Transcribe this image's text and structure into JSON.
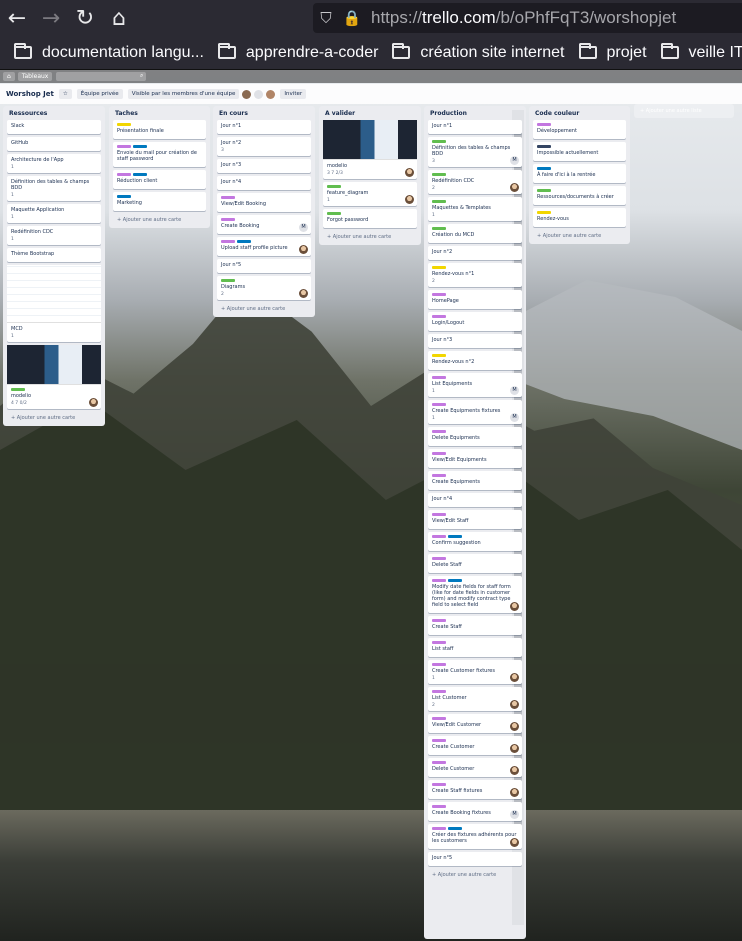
{
  "browser": {
    "url_prefix": "https://",
    "url_host": "trello.com",
    "url_path": "/b/oPhfFqT3/worshopjet",
    "bookmarks": [
      "documentation langu...",
      "apprendre-a-coder",
      "création site internet",
      "projet",
      "veille IT"
    ]
  },
  "trello": {
    "top_tab": "Tableaux",
    "board_name": "Worshop Jet",
    "team_button": "Équipe privée",
    "visible_button": "Visible par les membres d'une équipe",
    "invite_button": "Inviter",
    "add_list": "+ Ajouter une autre liste"
  },
  "lists": [
    {
      "title": "Ressources",
      "cards": [
        {
          "text": "Slack",
          "meta": ""
        },
        {
          "text": "GitHub",
          "meta": ""
        },
        {
          "text": "Architecture de l'App",
          "meta": "1"
        },
        {
          "text": "Définition des tables & champs BDD",
          "meta": "1"
        },
        {
          "text": "Maquette Application",
          "meta": "1"
        },
        {
          "text": "Redéfinition CDC",
          "meta": "1"
        },
        {
          "text": "Thème Bootstrap",
          "meta": ""
        },
        {
          "text": "MCD",
          "meta": "1"
        },
        {
          "text": "modelio",
          "meta": "4  7  0/2"
        }
      ],
      "add": "+ Ajouter une autre carte"
    },
    {
      "title": "Taches",
      "cards": [
        {
          "text": "Présentation finale",
          "meta": ""
        },
        {
          "text": "Envoie du mail pour création de staff password",
          "meta": ""
        },
        {
          "text": "Réduction client",
          "meta": ""
        },
        {
          "text": "Marketing",
          "meta": ""
        }
      ],
      "add": "+ Ajouter une autre carte"
    },
    {
      "title": "En cours",
      "cards": [
        {
          "text": "Jour n°1",
          "meta": ""
        },
        {
          "text": "Jour n°2",
          "meta": "3"
        },
        {
          "text": "Jour n°3",
          "meta": ""
        },
        {
          "text": "Jour n°4",
          "meta": ""
        },
        {
          "text": "View/Edit Booking",
          "meta": ""
        },
        {
          "text": "Create Booking",
          "meta": ""
        },
        {
          "text": "Upload staff profile picture",
          "meta": ""
        },
        {
          "text": "Jour n°5",
          "meta": ""
        },
        {
          "text": "Diagrams",
          "meta": "2"
        }
      ],
      "add": "+ Ajouter une autre carte"
    },
    {
      "title": "A valider",
      "cards": [
        {
          "text": "modelio",
          "meta": "3  7  2/3"
        },
        {
          "text": "feature_diagram",
          "meta": "1"
        },
        {
          "text": "Forgot password",
          "meta": ""
        }
      ],
      "add": "+ Ajouter une autre carte"
    },
    {
      "title": "Production",
      "cards": [
        {
          "text": "Jour n°1",
          "meta": ""
        },
        {
          "text": "Définition des tables & champs BDD",
          "meta": "3"
        },
        {
          "text": "Redéfinition CDC",
          "meta": "2"
        },
        {
          "text": "Maquettes & Templates",
          "meta": "1"
        },
        {
          "text": "Création du MCD",
          "meta": ""
        },
        {
          "text": "Jour n°2",
          "meta": ""
        },
        {
          "text": "Rendez-vous n°1",
          "meta": "2"
        },
        {
          "text": "HomePage",
          "meta": ""
        },
        {
          "text": "Login/Logout",
          "meta": ""
        },
        {
          "text": "Jour n°3",
          "meta": ""
        },
        {
          "text": "Rendez-vous n°2",
          "meta": ""
        },
        {
          "text": "List Equipments",
          "meta": "1"
        },
        {
          "text": "Create Equipments fixtures",
          "meta": "1"
        },
        {
          "text": "Delete Equipments",
          "meta": ""
        },
        {
          "text": "View/Edit Equipments",
          "meta": ""
        },
        {
          "text": "Create Equipments",
          "meta": ""
        },
        {
          "text": "Jour n°4",
          "meta": ""
        },
        {
          "text": "View/Edit Staff",
          "meta": ""
        },
        {
          "text": "Confirm suggestion",
          "meta": ""
        },
        {
          "text": "Delete Staff",
          "meta": ""
        },
        {
          "text": "Modify date fields for staff form (like for date fields in customer form) and modify contract type field to select field",
          "meta": ""
        },
        {
          "text": "Create Staff",
          "meta": ""
        },
        {
          "text": "List staff",
          "meta": ""
        },
        {
          "text": "Create Customer fixtures",
          "meta": "1"
        },
        {
          "text": "List Customer",
          "meta": "2"
        },
        {
          "text": "View/Edit Customer",
          "meta": ""
        },
        {
          "text": "Create Customer",
          "meta": ""
        },
        {
          "text": "Delete Customer",
          "meta": ""
        },
        {
          "text": "Create Staff fixtures",
          "meta": ""
        },
        {
          "text": "Create Booking fixtures",
          "meta": ""
        },
        {
          "text": "Créer des fixtures adhérents pour les customers",
          "meta": ""
        },
        {
          "text": "Jour n°5",
          "meta": ""
        }
      ],
      "add": "+ Ajouter une autre carte"
    },
    {
      "title": "Code couleur",
      "cards": [
        {
          "text": "Développement",
          "meta": ""
        },
        {
          "text": "Impossible actuellement",
          "meta": ""
        },
        {
          "text": "À faire d'ici à la rentrée",
          "meta": ""
        },
        {
          "text": "Ressources/documents à créer",
          "meta": ""
        },
        {
          "text": "Rendez-vous",
          "meta": ""
        }
      ],
      "add": "+ Ajouter une autre carte"
    }
  ],
  "colors": {
    "green": "#61bd4f",
    "yellow": "#f2d600",
    "purple": "#c377e0",
    "blue": "#0079bf",
    "dark": "#344563"
  }
}
